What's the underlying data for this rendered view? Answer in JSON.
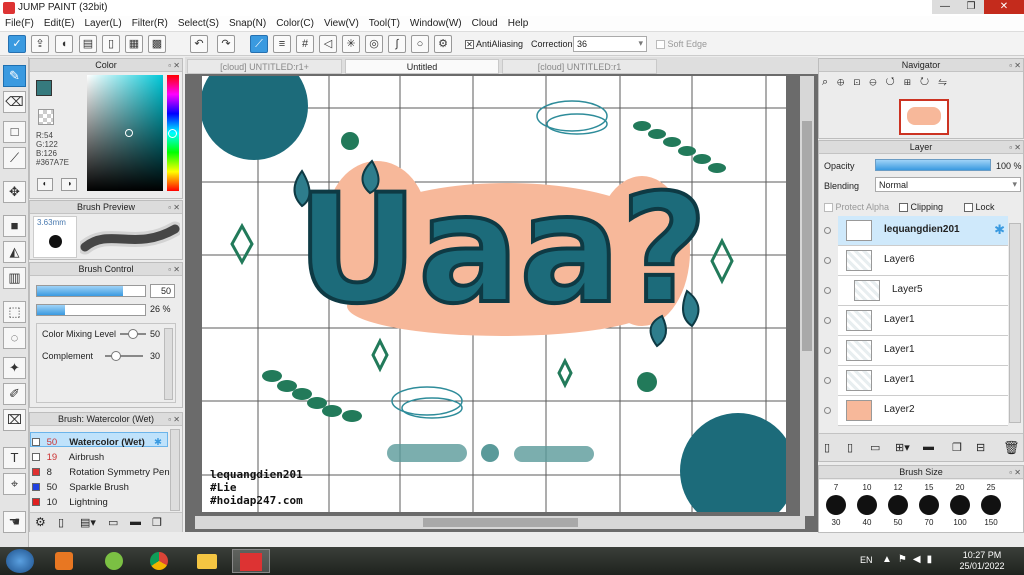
{
  "window": {
    "title": "JUMP PAINT (32bit)",
    "minimize": "—",
    "maximize": "❐",
    "close": "✕"
  },
  "menu": [
    "File(F)",
    "Edit(E)",
    "Layer(L)",
    "Filter(R)",
    "Select(S)",
    "Snap(N)",
    "Color(C)",
    "View(V)",
    "Tool(T)",
    "Window(W)",
    "Cloud",
    "Help"
  ],
  "toolbar": {
    "antialiasing_label": "AntiAliasing",
    "correction_label": "Correction",
    "correction_value": "36",
    "soft_edge_label": "Soft Edge"
  },
  "color_panel": {
    "title": "Color",
    "r": "R:54",
    "g": "G:122",
    "b": "B:126",
    "hex": "#367A7E",
    "current_color": "#367a7e"
  },
  "brush_preview": {
    "title": "Brush Preview",
    "size": "3.63mm"
  },
  "brush_control": {
    "title": "Brush Control",
    "size_value": "50",
    "opacity_value": "26 %",
    "color_mixing_label": "Color Mixing Level",
    "color_mixing_value": "50",
    "complement_label": "Complement",
    "complement_value": "30",
    "size_level": 0.5,
    "opacity_level": 0.26,
    "color_mixing_level": 0.5,
    "complement_level": 0.3
  },
  "brush_list": {
    "title": "Brush: Watercolor (Wet)",
    "items": [
      {
        "size": "50",
        "name": "Watercolor (Wet)",
        "color": "#f0f0f0"
      },
      {
        "size": "19",
        "name": "Airbrush",
        "color": "#f0f0f0"
      },
      {
        "size": "8",
        "name": "Rotation Symmetry Pen",
        "color": "#e03030"
      },
      {
        "size": "50",
        "name": "Sparkle Brush",
        "color": "#2040e0"
      },
      {
        "size": "10",
        "name": "Lightning",
        "color": "#e02020"
      }
    ]
  },
  "tabs": [
    {
      "label": "[cloud] UNTITLED:r1+"
    },
    {
      "label": "Untitled"
    },
    {
      "label": "[cloud] UNTITLED:r1"
    }
  ],
  "artwork": {
    "title": "Uaa?",
    "credit1": "lequangdien201",
    "credit2": "#Lie",
    "credit3": "#hoidap247.com"
  },
  "navigator": {
    "title": "Navigator"
  },
  "layer_panel": {
    "title": "Layer",
    "opacity_label": "Opacity",
    "opacity_value": "100 %",
    "blending_label": "Blending",
    "blending_value": "Normal",
    "protect_alpha_label": "Protect Alpha",
    "clipping_label": "Clipping",
    "lock_label": "Lock",
    "layers": [
      {
        "name": "lequangdien201"
      },
      {
        "name": "Layer6"
      },
      {
        "name": "Layer5"
      },
      {
        "name": "Layer1"
      },
      {
        "name": "Layer1"
      },
      {
        "name": "Layer1"
      },
      {
        "name": "Layer2"
      }
    ]
  },
  "brush_size": {
    "title": "Brush Size",
    "top": [
      "7",
      "10",
      "12",
      "15",
      "20",
      "25"
    ],
    "bottom": [
      "30",
      "40",
      "50",
      "70",
      "100",
      "150"
    ]
  },
  "taskbar": {
    "lang": "EN",
    "time": "10:27 PM",
    "date": "25/01/2022"
  },
  "colors": {
    "teal": "#1c6b7a",
    "accent_blue": "#3a9ae0",
    "peach": "#f7b89a",
    "leaf_green": "#227a5a"
  }
}
